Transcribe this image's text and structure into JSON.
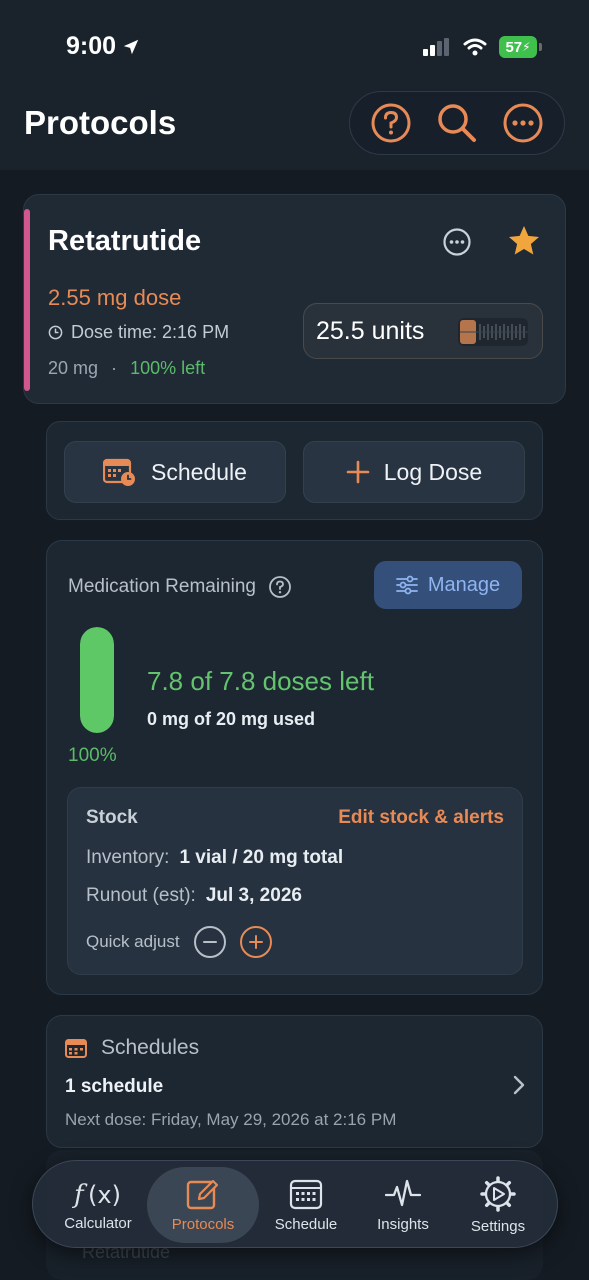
{
  "status_bar": {
    "time": "9:00",
    "battery": "57"
  },
  "header": {
    "title": "Protocols",
    "actions": [
      "help-icon",
      "search-icon",
      "more-icon"
    ]
  },
  "protocol": {
    "name": "Retatrutide",
    "dose": "2.55 mg dose",
    "dose_time": "Dose time: 2:16 PM",
    "vial_amount": "20 mg",
    "separator": "·",
    "percent_left": "100% left",
    "units": "25.5 units",
    "accent_color": "#d0588e"
  },
  "actions": {
    "schedule": "Schedule",
    "log_dose": "Log Dose"
  },
  "medication_remaining": {
    "title": "Medication Remaining",
    "manage": "Manage",
    "level_fraction": 1.0,
    "percent": "100%",
    "doses_left": "7.8 of 7.8 doses left",
    "used": "0 mg of 20 mg used",
    "stock": {
      "title": "Stock",
      "edit": "Edit stock & alerts",
      "inventory_label": "Inventory:",
      "inventory_value": "1 vial / 20 mg total",
      "runout_label": "Runout (est):",
      "runout_value": "Jul 3, 2026",
      "quick_adjust": "Quick adjust"
    }
  },
  "schedules": {
    "title": "Schedules",
    "count": "1 schedule",
    "next_dose": "Next dose: Friday, May 29, 2026 at 2:16 PM"
  },
  "ghost_card": {
    "name": "Retatrutide"
  },
  "tabbar": {
    "calculator": "Calculator",
    "protocols": "Protocols",
    "schedule": "Schedule",
    "insights": "Insights",
    "settings": "Settings"
  },
  "colors": {
    "accent_orange": "#e88a55",
    "green": "#5ec766",
    "manage_blue": "#8fb4f0"
  }
}
